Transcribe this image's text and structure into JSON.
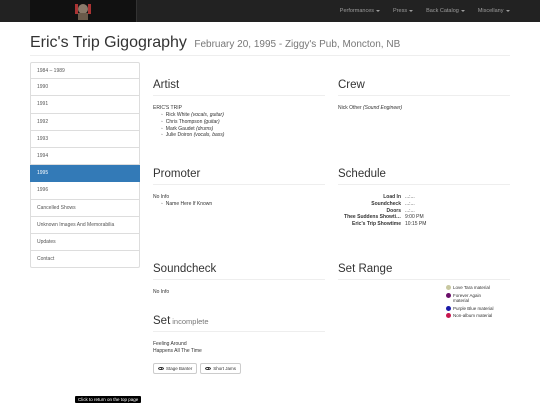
{
  "navbar": {
    "logo_icon": "band-logo-icon",
    "items": [
      {
        "label": "Performances"
      },
      {
        "label": "Press"
      },
      {
        "label": "Back Catalog"
      },
      {
        "label": "Miscellany"
      }
    ]
  },
  "page": {
    "title": "Eric's Trip Gigography",
    "subtitle": "February 20, 1995 - Ziggy's Pub, Moncton, NB"
  },
  "sidebar": {
    "items": [
      {
        "label": "1984 – 1989"
      },
      {
        "label": "1990"
      },
      {
        "label": "1991"
      },
      {
        "label": "1992"
      },
      {
        "label": "1993"
      },
      {
        "label": "1994"
      },
      {
        "label": "1995",
        "active": true
      },
      {
        "label": "1996"
      },
      {
        "label": "Cancelled Shows"
      },
      {
        "label": "Unknown Images And Memorabilia"
      },
      {
        "label": "Updates"
      },
      {
        "label": "Contact"
      }
    ]
  },
  "artist": {
    "heading": "Artist",
    "band": "ERIC'S TRIP",
    "members": [
      {
        "name": "Rick White",
        "role": "(vocals, guitar)"
      },
      {
        "name": "Chris Thompson",
        "role": "(guitar)"
      },
      {
        "name": "Mark Gaudet",
        "role": "(drums)"
      },
      {
        "name": "Julie Doiron",
        "role": "(vocals, bass)"
      }
    ]
  },
  "crew": {
    "heading": "Crew",
    "name": "Nick Other",
    "role": "(Sound Engineer)"
  },
  "promoter": {
    "heading": "Promoter",
    "text": "No Info",
    "items": [
      "Name Here If Known"
    ]
  },
  "schedule": {
    "heading": "Schedule",
    "rows": [
      {
        "label": "Load In",
        "value": "...:..."
      },
      {
        "label": "Soundcheck",
        "value": "...:..."
      },
      {
        "label": "Doors",
        "value": "...:..."
      },
      {
        "label": "Thee Suddens Showti…",
        "value": "9:00 PM"
      },
      {
        "label": "Eric's Trip Showtime",
        "value": "10:15 PM"
      }
    ]
  },
  "soundcheck": {
    "heading": "Soundcheck",
    "text": "No Info"
  },
  "set_range": {
    "heading": "Set Range",
    "legend": [
      {
        "label": "Love Tara material",
        "color": "#c8c8a0"
      },
      {
        "label": "Forever Again material",
        "color": "#6a0f6a"
      },
      {
        "label": "Purple Blue material",
        "color": "#1a1aa8"
      },
      {
        "label": "Non-album material",
        "color": "#c81850"
      }
    ]
  },
  "set": {
    "heading": "Set",
    "status": "incomplete",
    "songs": [
      "Feeling Around",
      "Happens All The Time"
    ],
    "buttons": [
      {
        "label": "Stage Banter"
      },
      {
        "label": "Short Jams"
      }
    ]
  },
  "tooltip": {
    "text": "Click to return on the top page"
  }
}
